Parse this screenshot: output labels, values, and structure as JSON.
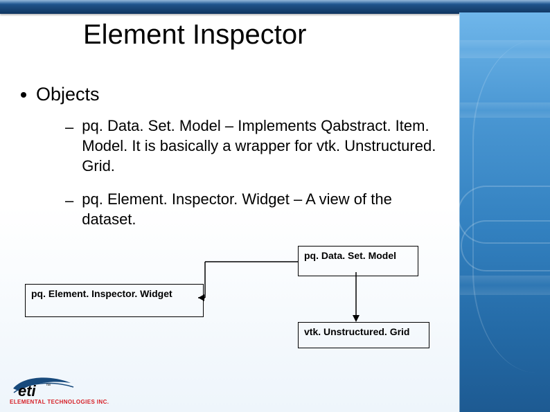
{
  "title": "Element Inspector",
  "bullet": "Objects",
  "sub_items": [
    "pq. Data. Set. Model – Implements Qabstract. Item. Model. It is basically a wrapper for vtk. Unstructured. Grid.",
    "pq. Element. Inspector. Widget – A view of the dataset."
  ],
  "diagram": {
    "box_top_right": "pq. Data. Set. Model",
    "box_left": "pq. Element. Inspector. Widget",
    "box_bottom_right": "vtk. Unstructured. Grid"
  },
  "logo": {
    "name": "eti",
    "subtitle": "ELEMENTAL TECHNOLOGIES INC."
  }
}
